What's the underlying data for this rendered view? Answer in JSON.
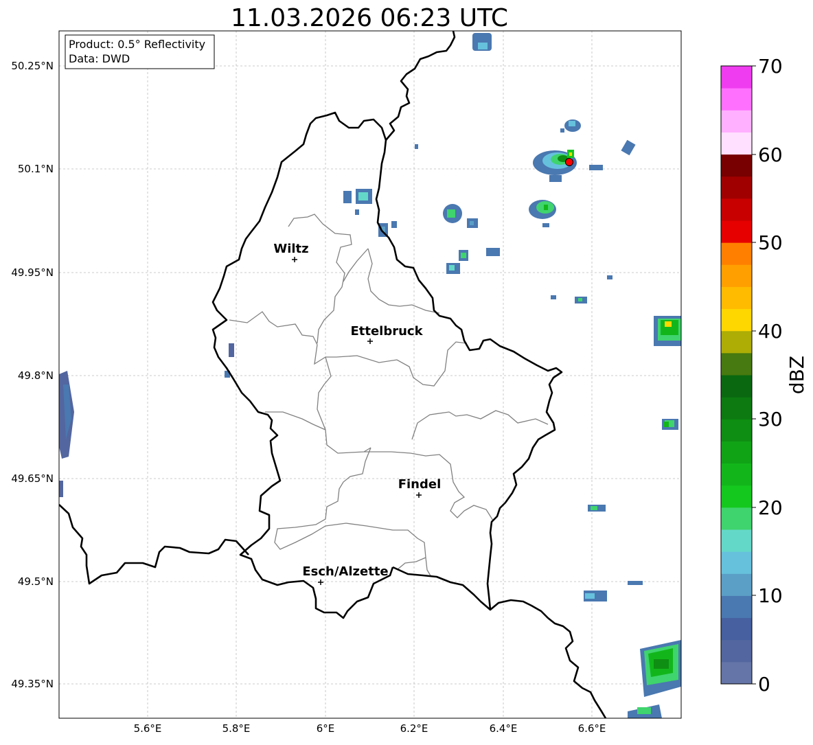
{
  "title": "11.03.2026 06:23 UTC",
  "info": {
    "product": "Product: 0.5° Reflectivity",
    "source": "Data: DWD"
  },
  "lat_ticks": [
    "50.25°N",
    "50.1°N",
    "49.95°N",
    "49.8°N",
    "49.65°N",
    "49.5°N",
    "49.35°N"
  ],
  "lon_ticks": [
    "5.6°E",
    "5.8°E",
    "6°E",
    "6.2°E",
    "6.4°E",
    "6.6°E"
  ],
  "cities": [
    "Wiltz",
    "Ettelbruck",
    "Findel",
    "Esch/Alzette"
  ],
  "colorbar": {
    "label": "dBZ",
    "ticks": [
      "70",
      "60",
      "50",
      "40",
      "30",
      "20",
      "10",
      "0"
    ],
    "range": [
      0,
      70
    ],
    "colors": [
      "#6575a8",
      "#53669f",
      "#4660a0",
      "#4a78b0",
      "#5b9fc6",
      "#66c1dd",
      "#64d8c8",
      "#3fd46d",
      "#14c81e",
      "#12b61a",
      "#10a316",
      "#0e8e12",
      "#0c7a10",
      "#0a6810",
      "#477a10",
      "#adad06",
      "#ffd700",
      "#ffbb00",
      "#ff9f00",
      "#ff8000",
      "#e60000",
      "#c80000",
      "#a00000",
      "#780000",
      "#ffe0ff",
      "#ffb0ff",
      "#ff70ff",
      "#f03cf0"
    ]
  },
  "colors": {
    "border": "#000000",
    "canton_lines": "#808080",
    "grid": "#bbbbbb",
    "marker": "#ff0000"
  }
}
